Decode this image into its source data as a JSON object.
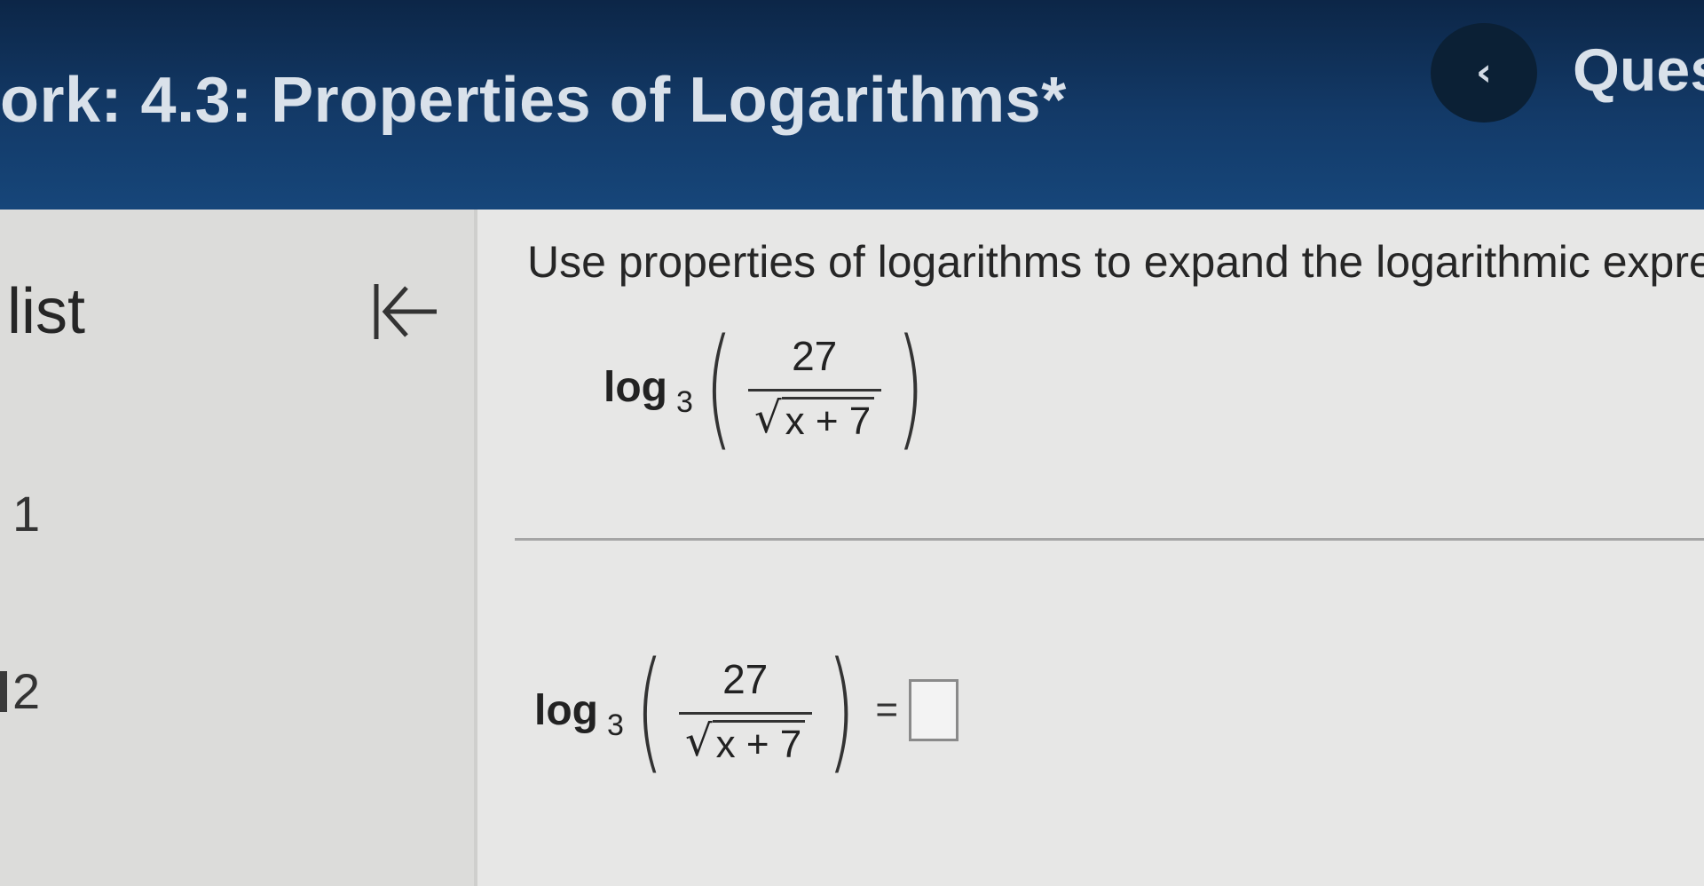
{
  "header": {
    "title": "ork:  4.3: Properties of Logarithms*",
    "prev_glyph": "‹",
    "right_label": "Ques"
  },
  "sidebar": {
    "title": "list",
    "items": [
      {
        "label": "1"
      },
      {
        "label": "2"
      }
    ]
  },
  "question": {
    "instruction": "Use properties of logarithms to expand the logarithmic express",
    "expression": {
      "function": "log",
      "base": "3",
      "numerator": "27",
      "radical_sign": "√",
      "radicand": "x + 7"
    },
    "answer": {
      "equals": "=",
      "value": ""
    }
  },
  "colors": {
    "header_bg": "#133a68",
    "header_text": "#d9e1ea",
    "prev_button_bg": "#0b2035",
    "page_bg": "#e4e4e3"
  },
  "icons": {
    "collapse": "collapse-left-arrow-icon",
    "previous": "chevron-left-icon"
  }
}
